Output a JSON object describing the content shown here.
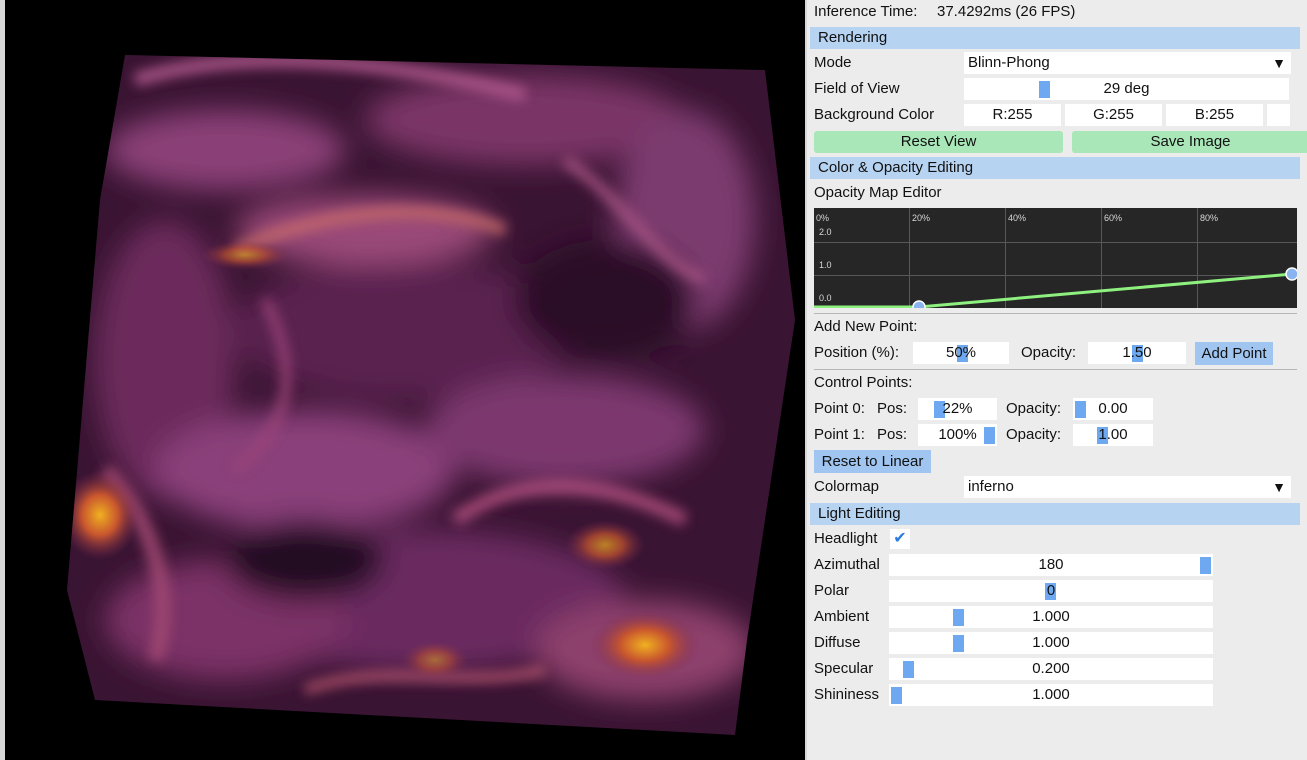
{
  "inference": {
    "label": "Inference Time:",
    "value": "37.4292ms (26 FPS)"
  },
  "rendering": {
    "header": "Rendering",
    "mode_label": "Mode",
    "mode_value": "Blinn-Phong",
    "fov_label": "Field of View",
    "fov_value": "29 deg",
    "bg_label": "Background Color",
    "bg_r": "R:255",
    "bg_g": "G:255",
    "bg_b": "B:255",
    "reset_view": "Reset View",
    "save_image": "Save Image"
  },
  "color_opacity": {
    "header": "Color & Opacity Editing",
    "editor_label": "Opacity Map Editor",
    "x_ticks": [
      "0%",
      "20%",
      "40%",
      "60%",
      "80%"
    ],
    "y_ticks": [
      "2.0",
      "1.0",
      "0.0"
    ],
    "add_point_label": "Add New Point:",
    "position_label": "Position (%):",
    "position_value": "50%",
    "opacity_label": "Opacity:",
    "opacity_value": "1.50",
    "add_point_button": "Add Point",
    "control_points_label": "Control Points:",
    "points": [
      {
        "label": "Point 0:",
        "pos_label": "Pos:",
        "pos_value": "22%",
        "opacity_label": "Opacity:",
        "opacity_value": "0.00"
      },
      {
        "label": "Point 1:",
        "pos_label": "Pos:",
        "pos_value": "100%",
        "opacity_label": "Opacity:",
        "opacity_value": "1.00"
      }
    ],
    "reset_linear": "Reset to Linear",
    "colormap_label": "Colormap",
    "colormap_value": "inferno"
  },
  "light": {
    "header": "Light Editing",
    "headlight_label": "Headlight",
    "headlight_checked": true,
    "rows": [
      {
        "label": "Azimuthal",
        "value": "180"
      },
      {
        "label": "Polar",
        "value": "0"
      },
      {
        "label": "Ambient",
        "value": "1.000"
      },
      {
        "label": "Diffuse",
        "value": "1.000"
      },
      {
        "label": "Specular",
        "value": "0.200"
      },
      {
        "label": "Shininess",
        "value": "1.000"
      }
    ]
  },
  "colors": {
    "section_header": "#b7d3f2",
    "green_button": "#a9e7b8",
    "blue_button": "#9fc5f0",
    "slider_knob": "#6da8f1",
    "opacity_line": "#8ef07e",
    "editor_bg": "#262626"
  }
}
